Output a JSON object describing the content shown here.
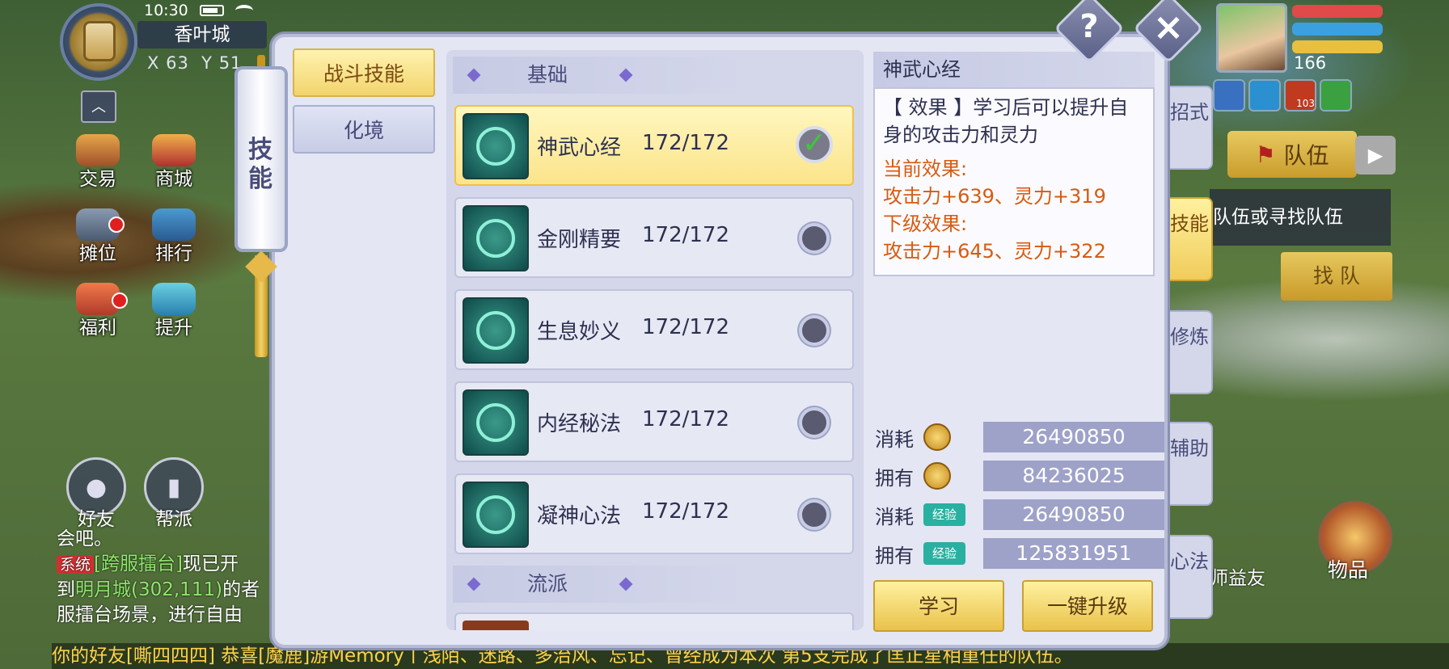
{
  "status": {
    "time": "10:30"
  },
  "location": {
    "city": "香叶城",
    "x_label": "X",
    "x": "63",
    "y_label": "Y",
    "y": "51"
  },
  "left_menu": [
    {
      "label": "交易",
      "icon": "trade-icon"
    },
    {
      "label": "商城",
      "icon": "shop-icon"
    },
    {
      "label": "摊位",
      "icon": "stall-icon"
    },
    {
      "label": "排行",
      "icon": "ranking-icon"
    },
    {
      "label": "福利",
      "icon": "welfare-icon"
    },
    {
      "label": "提升",
      "icon": "improve-icon"
    }
  ],
  "social": {
    "friends": "好友",
    "guild": "帮派"
  },
  "chat": {
    "line1": "会吧。",
    "sys_tag": "系统",
    "line2_a": "[跨服擂台]",
    "line2_b": "现已开",
    "line3_a": "到",
    "line3_b": "明月城(302,111)",
    "line3_c": "的者",
    "line4": "服擂台场景，进行自由"
  },
  "ticker": "你的好友[嘶四四四]  恭喜[魔鹿]游Memory丨浅陌、迷路、多治风、忘记、曾经成为本次      第5支完成了匡正星相重任的队伍。",
  "player": {
    "level": "166",
    "buff_count": "103"
  },
  "team": {
    "button": "队伍",
    "hint": "队伍或寻找队伍",
    "find": "找 队"
  },
  "items": {
    "label": "物品"
  },
  "friend_hint": "师益友",
  "panel": {
    "scroll_title": "技能",
    "categories": [
      {
        "label": "战斗技能",
        "active": true
      },
      {
        "label": "化境",
        "active": false
      }
    ],
    "sections": {
      "basic": "基础",
      "school": "流派"
    },
    "skills": [
      {
        "name": "神武心经",
        "level": "172/172",
        "selected": true
      },
      {
        "name": "金刚精要",
        "level": "172/172",
        "selected": false
      },
      {
        "name": "生息妙义",
        "level": "172/172",
        "selected": false
      },
      {
        "name": "内经秘法",
        "level": "172/172",
        "selected": false
      },
      {
        "name": "凝神心法",
        "level": "172/172",
        "selected": false
      }
    ],
    "detail": {
      "title": "神武心经",
      "effect": "【 效果 】学习后可以提升自身的攻击力和灵力",
      "current_label": "当前效果:",
      "current_value": "攻击力+639、灵力+319",
      "next_label": "下级效果:",
      "next_value": "攻击力+645、灵力+322"
    },
    "costs": [
      {
        "label": "消耗",
        "type": "coin",
        "value": "26490850"
      },
      {
        "label": "拥有",
        "type": "coin",
        "value": "84236025"
      },
      {
        "label": "消耗",
        "type": "exp",
        "exp_tag": "经验",
        "value": "26490850"
      },
      {
        "label": "拥有",
        "type": "exp",
        "exp_tag": "经验",
        "value": "125831951"
      }
    ],
    "buttons": {
      "learn": "学习",
      "upgrade_all": "一键升级"
    },
    "side_tabs": [
      {
        "label": "招式",
        "active": false
      },
      {
        "label": "技能",
        "active": true
      },
      {
        "label": "修炼",
        "active": false
      },
      {
        "label": "辅助",
        "active": false
      },
      {
        "label": "心法",
        "active": false
      }
    ]
  },
  "colors": {
    "accent_gold": "#f2d46c",
    "panel_bg": "#e4e6f3",
    "effect_red": "#d85a10"
  }
}
